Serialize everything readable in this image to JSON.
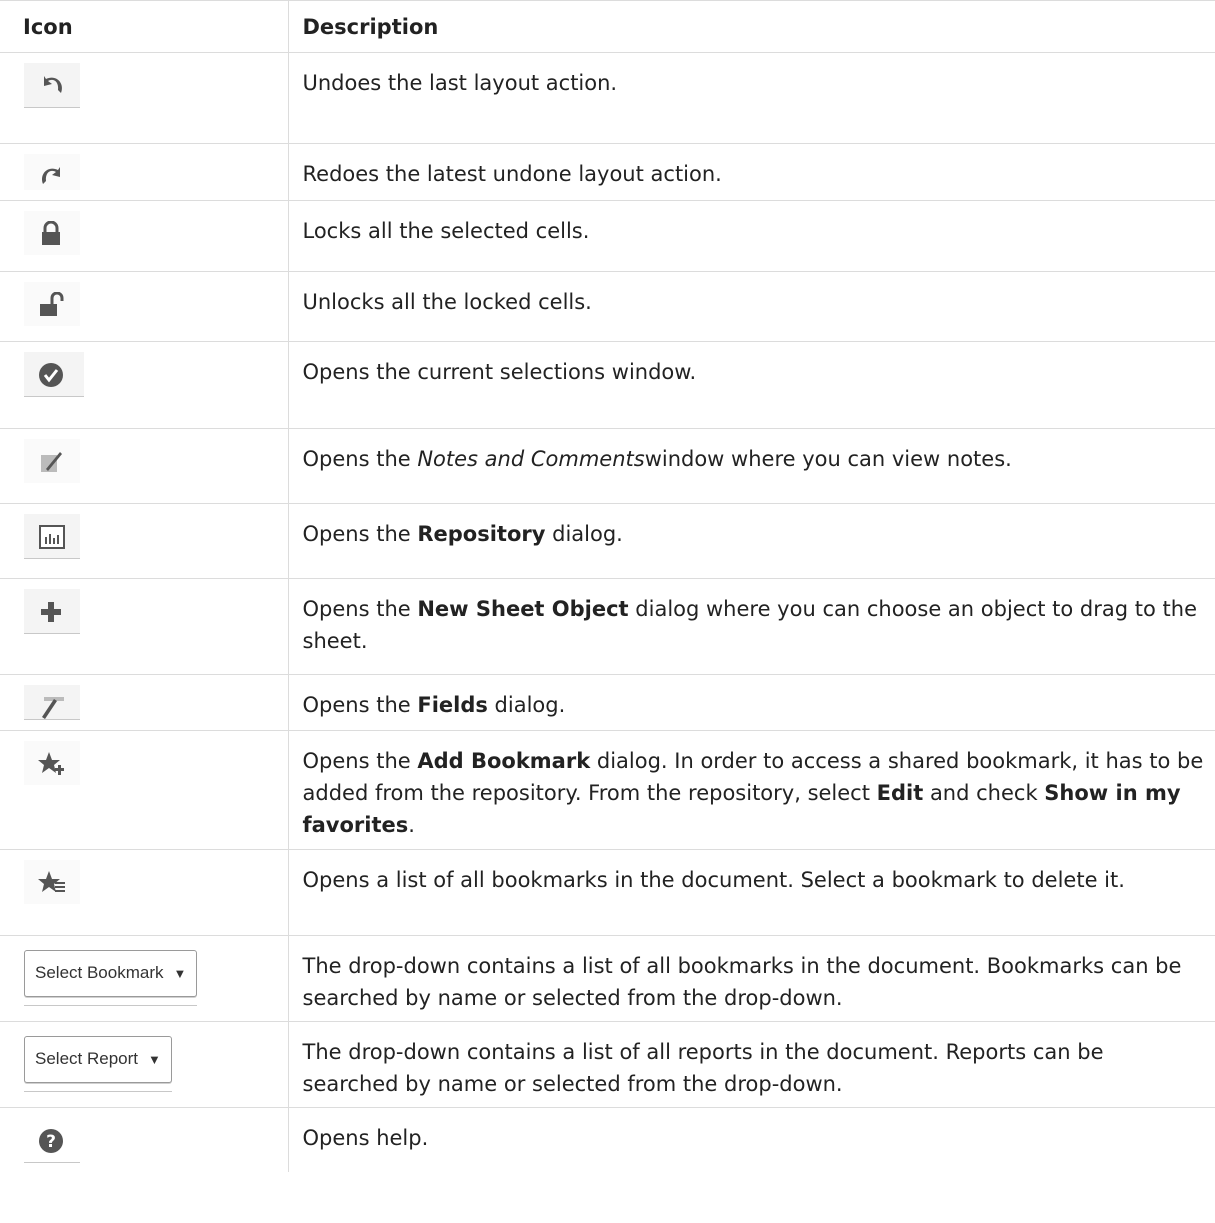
{
  "header": {
    "icon": "Icon",
    "description": "Description"
  },
  "rows": [
    {
      "icon": "undo-icon",
      "text": "Undoes the last layout action."
    },
    {
      "icon": "redo-icon",
      "text": "Redoes the latest undone layout action."
    },
    {
      "icon": "lock-icon",
      "text": "Locks all the selected cells."
    },
    {
      "icon": "unlock-icon",
      "text": "Unlocks all the locked cells."
    },
    {
      "icon": "check-circle-icon",
      "text": "Opens the current selections window."
    },
    {
      "icon": "note-icon",
      "pre": "Opens the ",
      "em": "Notes and Comments",
      "post": "window where you can view notes."
    },
    {
      "icon": "repository-chart-icon",
      "pre": "Opens the ",
      "strong": "Repository",
      "post": " dialog."
    },
    {
      "icon": "plus-icon",
      "pre": "Opens the ",
      "strong": "New Sheet Object",
      "post": " dialog where you can choose an object to drag to the sheet."
    },
    {
      "icon": "fields-icon",
      "pre": "Opens the ",
      "strong": "Fields",
      "post": " dialog."
    },
    {
      "icon": "bookmark-add-icon",
      "pre": "Opens the ",
      "strong": "Add Bookmark",
      "post": " dialog. In order to access a shared bookmark, it has to be added from the repository. From the repository, select ",
      "strong2": "Edit",
      "post2": " and check ",
      "strong3": "Show in my favorites",
      "post3": "."
    },
    {
      "icon": "bookmark-list-icon",
      "text": "Opens a list of all bookmarks in the document. Select a bookmark to delete it."
    },
    {
      "dropdown": "Select Bookmark",
      "text": "The drop-down contains a list of all bookmarks in the document. Bookmarks can be searched by name or selected from the drop-down."
    },
    {
      "dropdown": "Select Report",
      "text": "The drop-down contains a list of all reports in the document. Reports can be searched by name or selected from the drop-down."
    },
    {
      "icon": "help-icon",
      "text": "Opens help."
    }
  ]
}
